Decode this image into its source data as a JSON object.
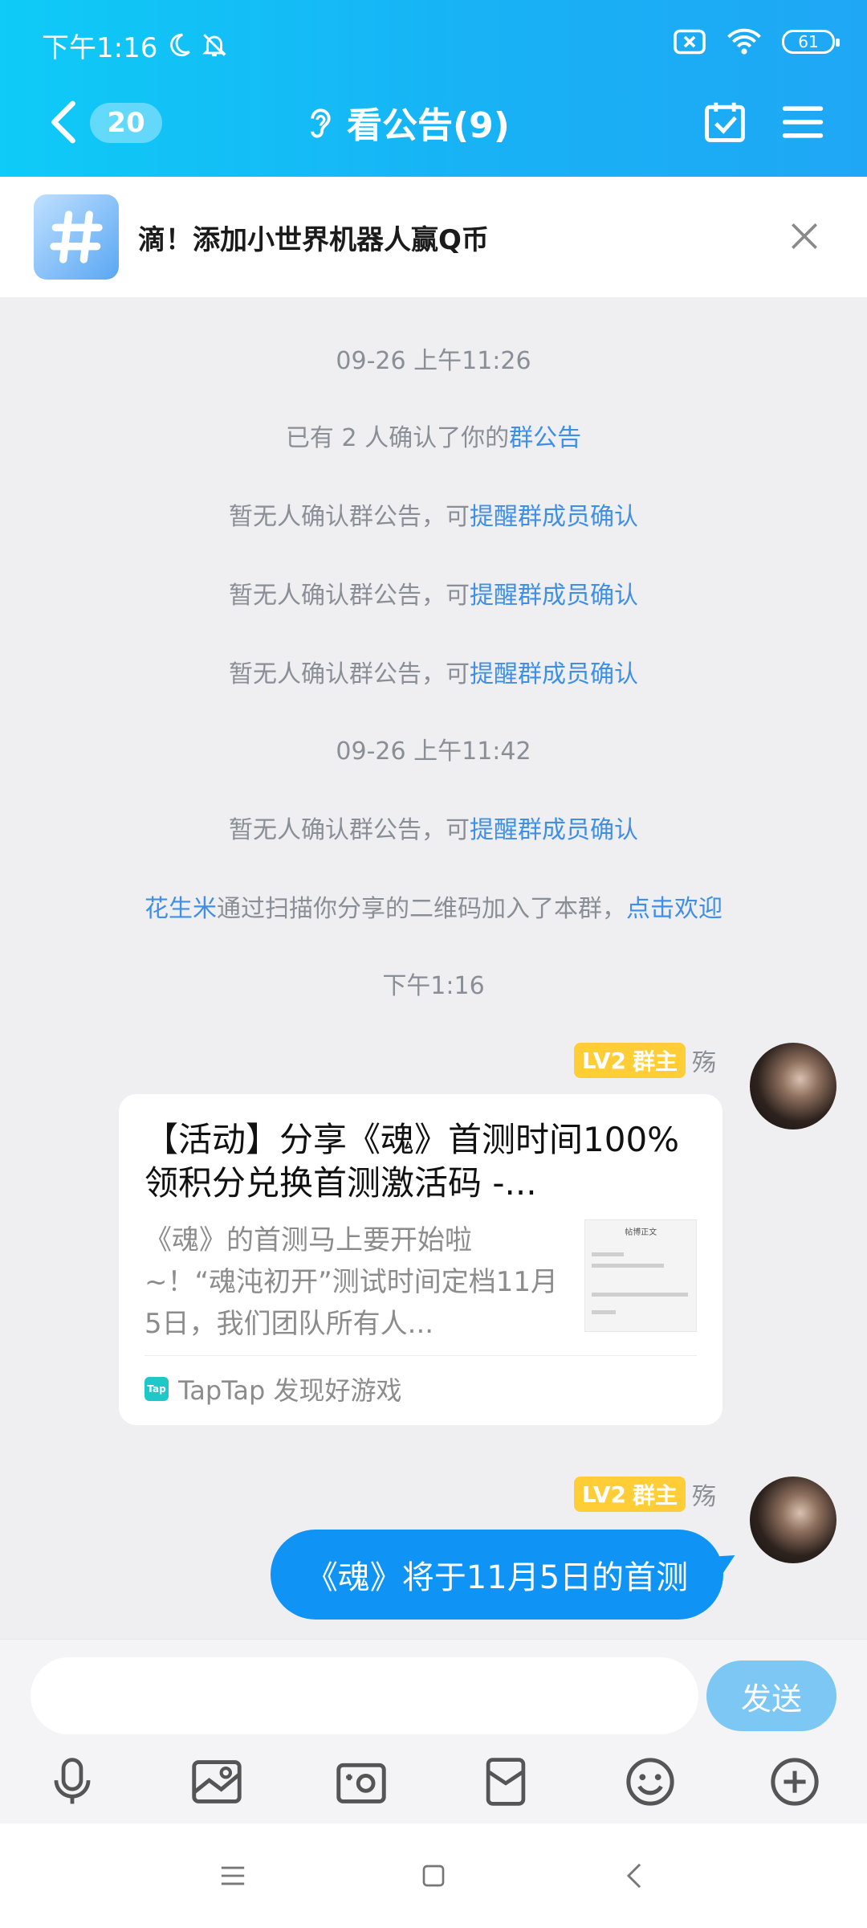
{
  "status_bar": {
    "time": "下午1:16",
    "battery": "61"
  },
  "header": {
    "unread_count": "20",
    "title": "看公告(9)"
  },
  "banner": {
    "text": "滴！添加小世界机器人赢Q币"
  },
  "system_messages": [
    {
      "text": "09-26 上午11:26",
      "link": ""
    },
    {
      "text": "已有 2 人确认了你的",
      "link": "群公告"
    },
    {
      "text": "暂无人确认群公告，可",
      "link": "提醒群成员确认"
    },
    {
      "text": "暂无人确认群公告，可",
      "link": "提醒群成员确认"
    },
    {
      "text": "暂无人确认群公告，可",
      "link": "提醒群成员确认"
    },
    {
      "text": "09-26 上午11:42",
      "link": ""
    },
    {
      "text": "暂无人确认群公告，可",
      "link": "提醒群成员确认"
    }
  ],
  "join_message": {
    "name": "花生米",
    "text": "通过扫描你分享的二维码加入了本群，",
    "link": "点击欢迎"
  },
  "time_label": "下午1:16",
  "sender": {
    "level": "LV2",
    "role": "群主",
    "name": "殇"
  },
  "share_card": {
    "title": "【活动】分享《魂》首测时间100%领积分兑换首测激活码 -...",
    "description": "《魂》的首测马上要开始啦~！“魂沌初开”测试时间定档11月5日，我们团队所有人...",
    "thumb_title": "帖博正文",
    "source": "TapTap 发现好游戏",
    "logo_text": "Tap"
  },
  "text_message": "《魂》将于11月5日的首测",
  "input": {
    "placeholder": "",
    "send_label": "发送"
  },
  "colors": {
    "header": "#18b2f5",
    "bubble": "#0f94f5",
    "link": "#3f8fe6",
    "badge": "#ffce37"
  }
}
